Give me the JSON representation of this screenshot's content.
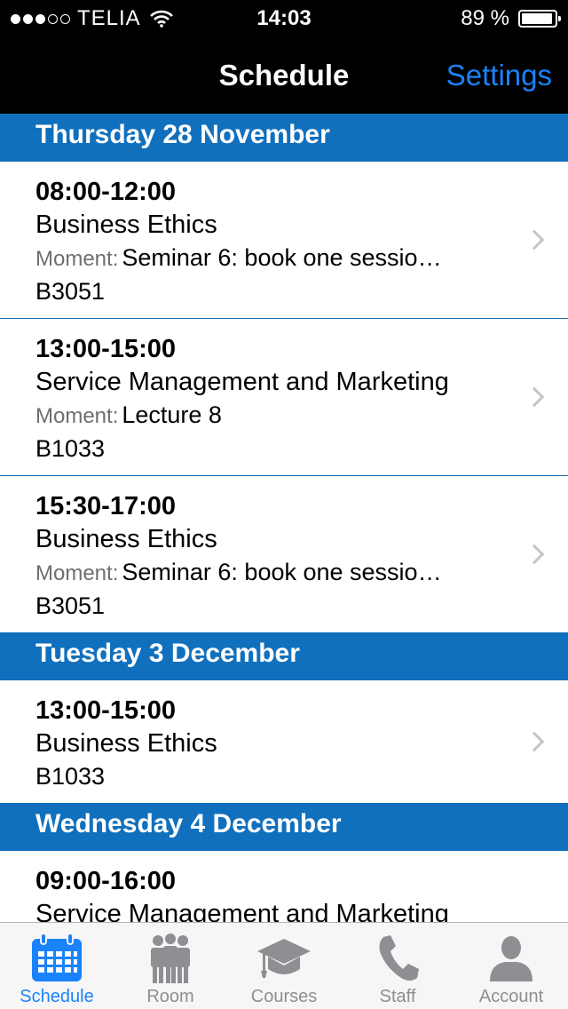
{
  "status": {
    "carrier": "TELIA",
    "time": "14:03",
    "battery": "89 %"
  },
  "nav": {
    "title": "Schedule",
    "settings_label": "Settings"
  },
  "sections": [
    {
      "date": "Thursday 28 November",
      "events": [
        {
          "time": "08:00-12:00",
          "course": "Business Ethics",
          "moment_label": "Moment:",
          "moment": "Seminar 6: book one sessio…",
          "room": "B3051"
        },
        {
          "time": "13:00-15:00",
          "course": "Service Management and Marketing",
          "moment_label": "Moment:",
          "moment": "Lecture 8",
          "room": "B1033"
        },
        {
          "time": "15:30-17:00",
          "course": "Business Ethics",
          "moment_label": "Moment:",
          "moment": "Seminar 6: book one sessio…",
          "room": "B3051"
        }
      ]
    },
    {
      "date": "Tuesday 3 December",
      "events": [
        {
          "time": "13:00-15:00",
          "course": "Business Ethics",
          "room": "B1033"
        }
      ]
    },
    {
      "date": "Wednesday 4 December",
      "events": [
        {
          "time": "09:00-16:00",
          "course": "Service Management and Marketing"
        }
      ]
    }
  ],
  "tabs": [
    {
      "label": "Schedule",
      "icon": "calendar-icon",
      "active": true
    },
    {
      "label": "Room",
      "icon": "people-icon",
      "active": false
    },
    {
      "label": "Courses",
      "icon": "graduation-cap-icon",
      "active": false
    },
    {
      "label": "Staff",
      "icon": "phone-icon",
      "active": false
    },
    {
      "label": "Account",
      "icon": "person-icon",
      "active": false
    }
  ],
  "colors": {
    "nav_background": "#000000",
    "section_header": "#1170bd",
    "accent": "#1a82fb",
    "tab_inactive": "#8e8e93"
  }
}
